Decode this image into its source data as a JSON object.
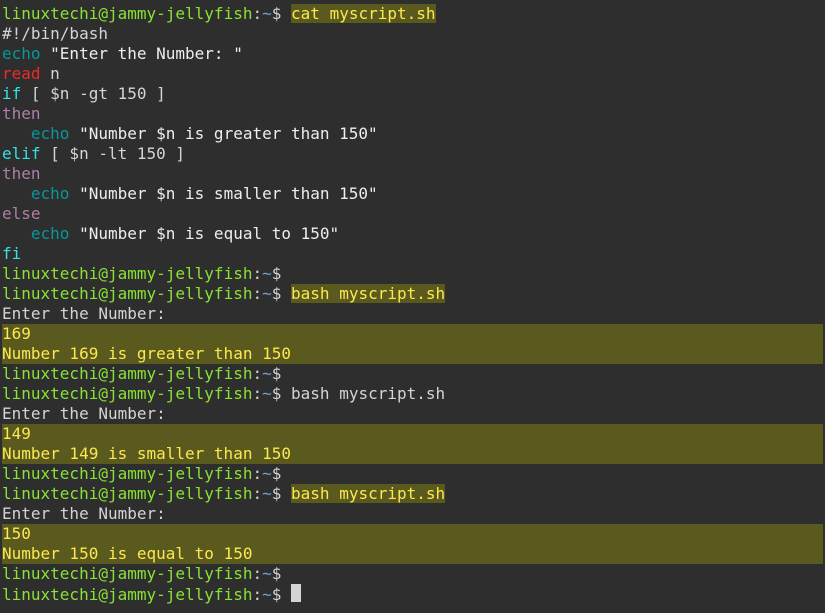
{
  "prompt": {
    "user": "linuxtechi",
    "sep1": "@",
    "host": "jammy-jellyfish",
    "sep2": ":",
    "path": "~",
    "dollar": "$"
  },
  "cmds": {
    "cat": "cat myscript.sh",
    "bash": "bash myscript.sh"
  },
  "script": {
    "shebang": "#!/bin/bash",
    "echo1_kw": "echo",
    "echo1_str": " \"Enter the Number: \"",
    "read_kw": "read",
    "read_var": " n",
    "if_kw": "if",
    "if_cond": " [ $n -gt 150 ]",
    "then1": "then",
    "echo2_indent": "   ",
    "echo2_kw": "echo",
    "echo2_str": " \"Number $n is greater than 150\"",
    "elif_kw": "elif",
    "elif_cond": " [ $n -lt 150 ]",
    "then2": "then",
    "echo3_indent": "   ",
    "echo3_kw": "echo",
    "echo3_str": " \"Number $n is smaller than 150\"",
    "else_kw": "else",
    "echo4_indent": "   ",
    "echo4_kw": "echo",
    "echo4_str": " \"Number $n is equal to 150\"",
    "fi_kw": "fi"
  },
  "run1": {
    "prompt_txt": "Enter the Number:",
    "input": "169",
    "output": "Number 169 is greater than 150"
  },
  "run2": {
    "prompt_txt": "Enter the Number:",
    "input": "149",
    "output": "Number 149 is smaller than 150"
  },
  "run3": {
    "prompt_txt": "Enter the Number:",
    "input": "150",
    "output": "Number 150 is equal to 150"
  }
}
